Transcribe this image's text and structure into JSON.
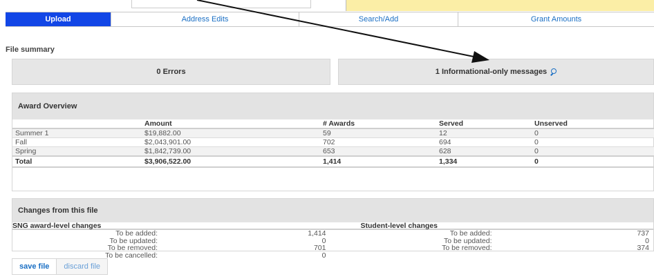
{
  "tabs": [
    "Upload",
    "Address Edits",
    "Search/Add",
    "Grant Amounts"
  ],
  "active_tab": "Upload",
  "file_summary": {
    "title": "File summary",
    "errors": "0 Errors",
    "info_messages": "1 Informational-only messages"
  },
  "award_overview": {
    "title": "Award Overview",
    "columns": [
      "",
      "Amount",
      "# Awards",
      "Served",
      "Unserved"
    ],
    "rows": [
      {
        "term": "Summer 1",
        "amount": "$19,882.00",
        "awards": "59",
        "served": "12",
        "unserved": "0"
      },
      {
        "term": "Fall",
        "amount": "$2,043,901.00",
        "awards": "702",
        "served": "694",
        "unserved": "0"
      },
      {
        "term": "Spring",
        "amount": "$1,842,739.00",
        "awards": "653",
        "served": "628",
        "unserved": "0"
      }
    ],
    "total": {
      "term": "Total",
      "amount": "$3,906,522.00",
      "awards": "1,414",
      "served": "1,334",
      "unserved": "0"
    }
  },
  "changes": {
    "title": "Changes from this file",
    "award_level": {
      "header": "SNG award-level changes",
      "rows": [
        {
          "label": "To be added:",
          "value": "1,414"
        },
        {
          "label": "To be updated:",
          "value": "0"
        },
        {
          "label": "To be removed:",
          "value": "701"
        },
        {
          "label": "To be cancelled:",
          "value": "0"
        }
      ]
    },
    "student_level": {
      "header": "Student-level changes",
      "rows": [
        {
          "label": "To be added:",
          "value": "737"
        },
        {
          "label": "To be updated:",
          "value": "0"
        },
        {
          "label": "To be removed:",
          "value": "374"
        }
      ]
    }
  },
  "buttons": {
    "save": "save file",
    "discard": "discard file"
  },
  "colors": {
    "active_tab": "#1246e6",
    "link": "#1a6fc4",
    "panel_header": "#e3e3e3",
    "top_bar": "#fbeea6"
  }
}
